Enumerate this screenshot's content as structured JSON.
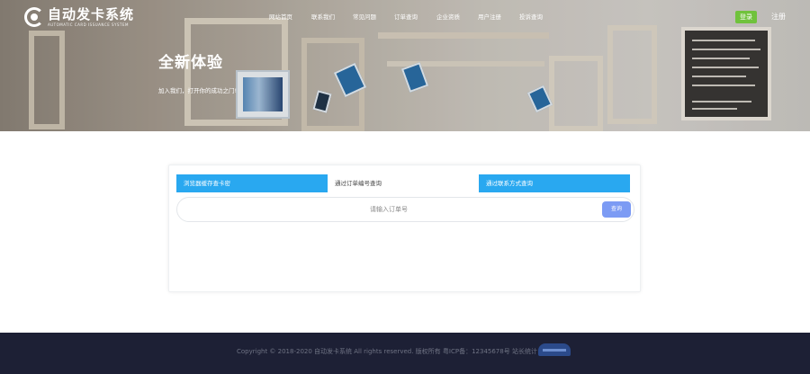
{
  "brand": {
    "title": "自动发卡系统",
    "subtitle": "AUTOMATIC CARD ISSUANCE SYSTEM"
  },
  "nav": {
    "items": [
      {
        "label": "网站首页"
      },
      {
        "label": "联系我们"
      },
      {
        "label": "常见问题"
      },
      {
        "label": "订单查询"
      },
      {
        "label": "企业资质"
      },
      {
        "label": "用户注册"
      },
      {
        "label": "投诉查询"
      }
    ],
    "login_label": "登录",
    "register_label": "注册"
  },
  "hero": {
    "title": "全新体验",
    "subtitle": "加入我们，打开你的成功之门!"
  },
  "query": {
    "tabs": [
      {
        "label": "浏览器缓存查卡密",
        "active": true
      },
      {
        "label": "通过订单编号查询",
        "active": false
      },
      {
        "label": "通过联系方式查询",
        "active": true
      }
    ],
    "placeholder": "请输入订单号",
    "button_label": "查询"
  },
  "footer": {
    "text": "Copyright © 2018-2020 自动发卡系统 All rights reserved. 版权所有 粤ICP备：12345678号 站长统计"
  },
  "colors": {
    "accent": "#29a8f0",
    "login_green": "#70c23c",
    "query_button": "#7c9bf4",
    "footer_bg": "#1d2035"
  }
}
